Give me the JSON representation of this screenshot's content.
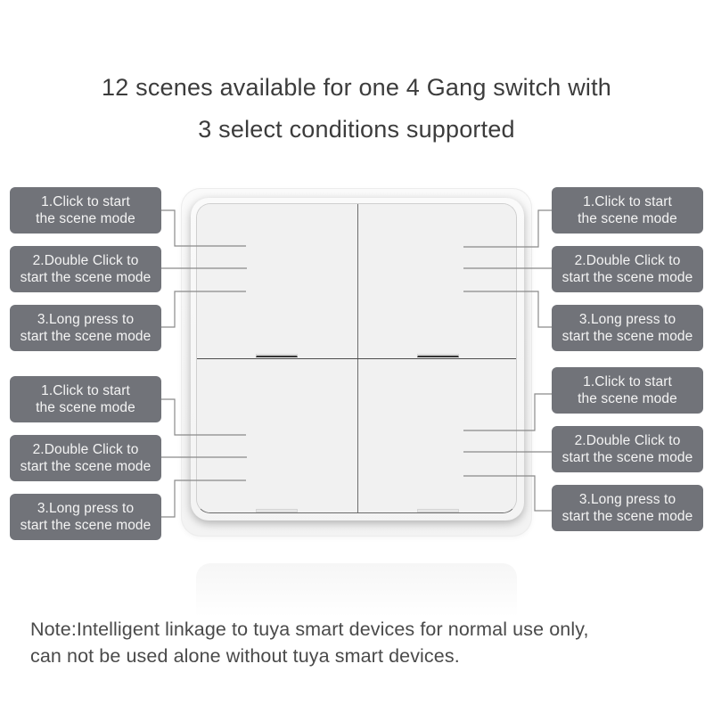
{
  "header": {
    "line1": "12 scenes available for one 4 Gang switch with",
    "line2": "3 select conditions supported"
  },
  "switch": {
    "type": "4 Gang switch",
    "buttons": [
      "top-left",
      "top-right",
      "bottom-left",
      "bottom-right"
    ]
  },
  "callout_groups": [
    {
      "button": "top-left",
      "labels": [
        {
          "line1": "1.Click to start",
          "line2": "the scene mode"
        },
        {
          "line1": "2.Double Click to",
          "line2": "start the scene mode"
        },
        {
          "line1": "3.Long press to",
          "line2": "start the scene mode"
        }
      ]
    },
    {
      "button": "top-right",
      "labels": [
        {
          "line1": "1.Click to start",
          "line2": "the scene mode"
        },
        {
          "line1": "2.Double Click to",
          "line2": "start the scene mode"
        },
        {
          "line1": "3.Long press to",
          "line2": "start the scene mode"
        }
      ]
    },
    {
      "button": "bottom-left",
      "labels": [
        {
          "line1": "1.Click to start",
          "line2": "the scene mode"
        },
        {
          "line1": "2.Double Click to",
          "line2": "start the scene mode"
        },
        {
          "line1": "3.Long press to",
          "line2": "start the scene mode"
        }
      ]
    },
    {
      "button": "bottom-right",
      "labels": [
        {
          "line1": "1.Click to start",
          "line2": "the scene mode"
        },
        {
          "line1": "2.Double Click to",
          "line2": "start the scene mode"
        },
        {
          "line1": "3.Long press to",
          "line2": "start the scene mode"
        }
      ]
    }
  ],
  "note": {
    "line1": "Note:Intelligent linkage to tuya smart devices for normal use only,",
    "line2": "can not be used alone without tuya smart devices."
  },
  "colors": {
    "label_bg": "#717379",
    "label_text": "#f4f4f4",
    "title_text": "#3c3c3c",
    "switch_surface": "#f1f1f1"
  }
}
